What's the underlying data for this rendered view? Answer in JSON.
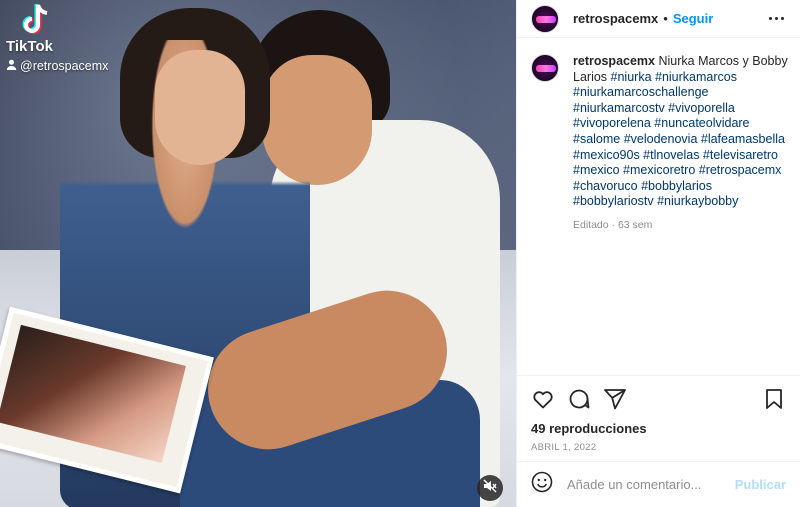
{
  "media": {
    "watermark": {
      "brand": "TikTok",
      "handle": "@retrospacemx"
    },
    "mute_icon": "speaker-muted-icon"
  },
  "header": {
    "username": "retrospacemx",
    "separator": "•",
    "follow_label": "Seguir",
    "more_icon": "more-horizontal-icon"
  },
  "caption": {
    "username": "retrospacemx",
    "text": "Niurka Marcos y Bobby Larios",
    "hashtags": "#niurka #niurkamarcos #niurkamarcoschallenge #niurkamarcostv #vivoporella #vivoporelena #nuncateolvidare #salome #velodenovia #lafeamasbella #mexico90s #tlnovelas #televisaretro #mexico #mexicoretro #retrospacemx #chavoruco #bobbylarios #bobbylariostv #niurkaybobby",
    "meta": "Editado · 63 sem"
  },
  "actions": {
    "like_icon": "heart-icon",
    "comment_icon": "comment-icon",
    "share_icon": "share-icon",
    "save_icon": "bookmark-icon"
  },
  "stats": {
    "views": "49 reproducciones",
    "date": "ABRIL 1, 2022"
  },
  "comment": {
    "emoji_icon": "emoji-icon",
    "placeholder": "Añade un comentario...",
    "publish_label": "Publicar"
  },
  "colors": {
    "link_blue": "#0095f6",
    "hashtag_blue": "#00376b",
    "muted_gray": "#8e8e8e",
    "publish_disabled": "#b2dffc"
  }
}
